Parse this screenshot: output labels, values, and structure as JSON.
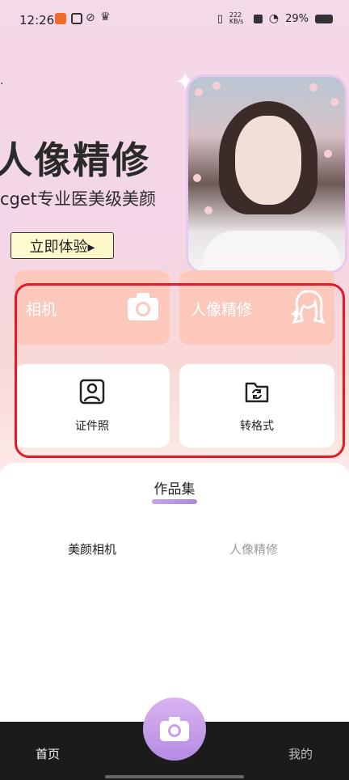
{
  "status_bar": {
    "time": "12:26",
    "network_speed": "222 KB/s",
    "battery": "29%"
  },
  "banner": {
    "title": "人像精修",
    "subtitle": "cget专业医美级美颜",
    "cta_label": "立即体验▸"
  },
  "features": [
    {
      "label": "相机",
      "icon": "camera-icon"
    },
    {
      "label": "人像精修",
      "icon": "woman-face-icon"
    },
    {
      "label": "证件照",
      "icon": "id-photo-icon"
    },
    {
      "label": "转格式",
      "icon": "folder-convert-icon"
    }
  ],
  "works": {
    "title": "作品集",
    "tabs": [
      {
        "label": "美颜相机",
        "active": true
      },
      {
        "label": "人像精修",
        "active": false
      }
    ]
  },
  "nav": {
    "home": "首页",
    "me": "我的"
  },
  "colors": {
    "accent_card": "#fbc8bb",
    "outline": "#e11b2a",
    "camera_button": "#c9a0ec"
  }
}
